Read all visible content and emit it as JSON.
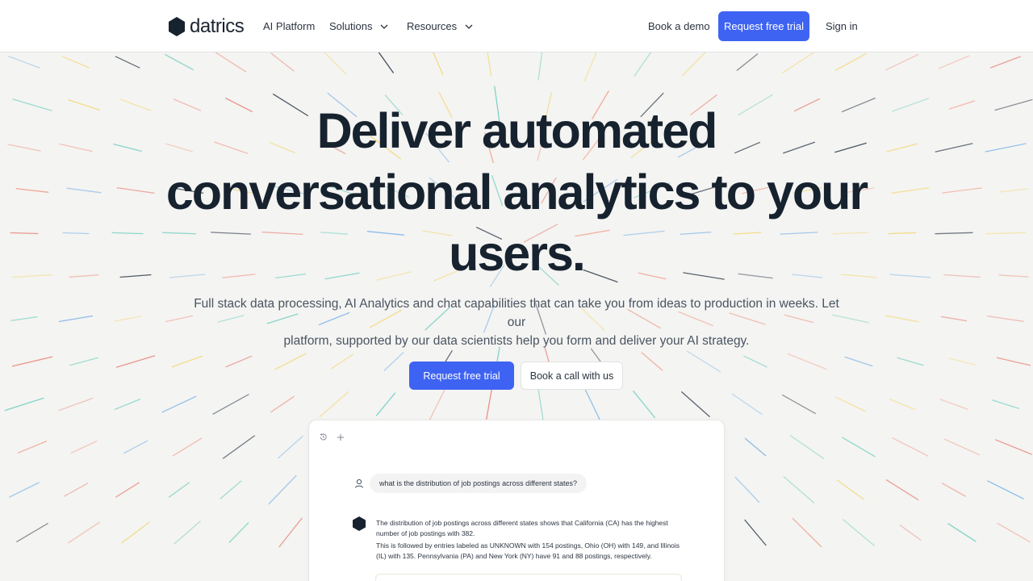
{
  "header": {
    "logo_text": "datrics",
    "nav": [
      {
        "label": "AI Platform",
        "has_dropdown": false
      },
      {
        "label": "Solutions",
        "has_dropdown": true
      },
      {
        "label": "Resources",
        "has_dropdown": true
      }
    ],
    "book_demo": "Book a demo",
    "request_trial": "Request free trial",
    "sign_in": "Sign in"
  },
  "hero": {
    "title_line1": "Deliver automated",
    "title_line2": "conversational analytics to your",
    "title_line3": "users.",
    "subtitle_line1": "Full stack data processing, AI Analytics and chat capabilities that can take you from ideas to production in weeks. Let our",
    "subtitle_line2": "platform, supported by our data scientists help you form and deliver your AI strategy.",
    "primary_cta": "Request free trial",
    "secondary_cta": "Book a call with us"
  },
  "chat": {
    "toolbar_icons": [
      "history-icon",
      "plus-icon"
    ],
    "user_message": "what is the distribution of job postings across different states?",
    "bot_paragraph_1": "The distribution of job postings across different states shows that California (CA) has the highest number of job postings with 382.",
    "bot_paragraph_2": "This is followed by entries labeled as UNKNOWN with 154 postings, Ohio (OH) with 149, and Illinois (IL) with 135. Pennsylvania (PA) and New York (NY) have 91 and 88 postings, respectively."
  },
  "colors": {
    "accent": "#3e63f2",
    "background": "#f4f4f2",
    "text_dark": "#17222f",
    "line_palette": [
      "#f2a08f",
      "#6fcfc0",
      "#f5d774",
      "#7fb6e8",
      "#e88478",
      "#2d3a4a"
    ]
  }
}
